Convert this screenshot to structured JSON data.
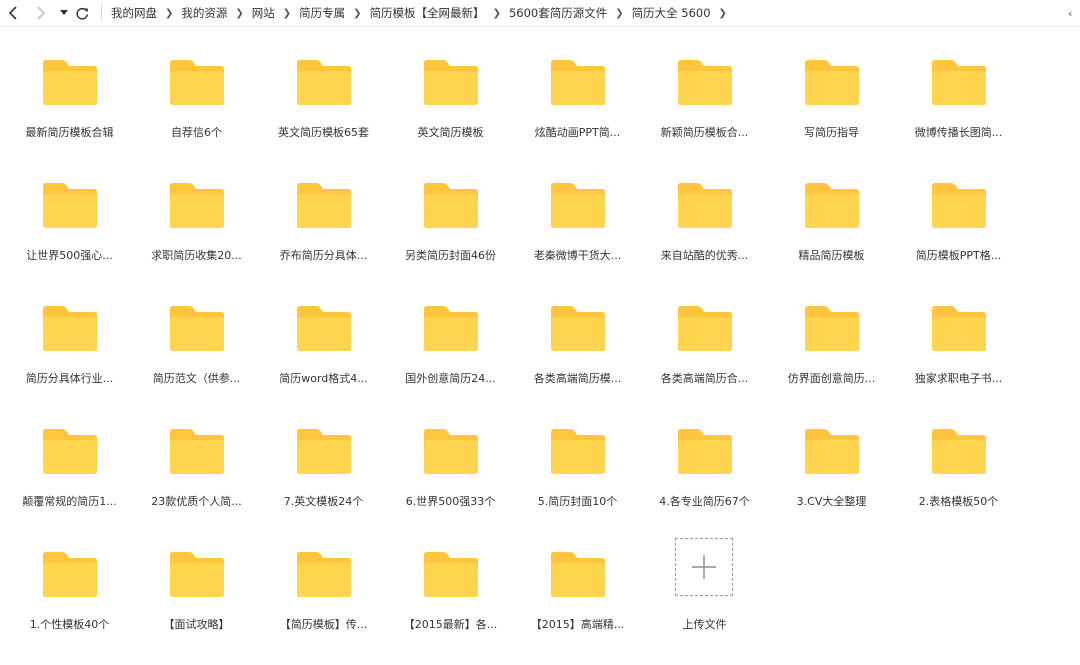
{
  "toolbar": {
    "back_icon": "chevron-left-icon",
    "forward_icon": "chevron-right-icon",
    "dropdown_icon": "caret-down-icon",
    "refresh_icon": "refresh-icon"
  },
  "breadcrumb": [
    "我的网盘",
    "我的资源",
    "网站",
    "简历专属",
    "简历模板【全网最新】",
    "5600套简历源文件",
    "简历大全 5600"
  ],
  "colors": {
    "folder_front": "#FFD54F",
    "folder_back": "#FFC53D",
    "text": "#333333"
  },
  "folders": [
    "最新简历模板合辑",
    "自荐信6个",
    "英文简历模板65套",
    "英文简历模板",
    "炫酷动画PPT简...",
    "新颖简历模板合...",
    "写简历指导",
    "微博传播长图简...",
    "让世界500强心...",
    "求职简历收集20...",
    "乔布简历分具体...",
    "另类简历封面46份",
    "老秦微博干货大...",
    "来自站酷的优秀...",
    "精品简历模板",
    "简历模板PPT格...",
    "简历分具体行业...",
    "简历范文（供参...",
    "简历word格式4...",
    "国外创意简历24...",
    "各类高端简历模...",
    "各类高端简历合...",
    "仿界面创意简历...",
    "独家求职电子书...",
    "颠覆常规的简历1...",
    "23款优质个人简...",
    "7.英文模板24个",
    "6.世界500强33个",
    "5.简历封面10个",
    "4.各专业简历67个",
    "3.CV大全整理",
    "2.表格模板50个",
    "1.个性模板40个",
    "【面试攻略】",
    "【简历模板】传...",
    "【2015最新】各...",
    "【2015】高端精..."
  ],
  "upload": {
    "label": "上传文件",
    "icon": "plus-icon"
  }
}
